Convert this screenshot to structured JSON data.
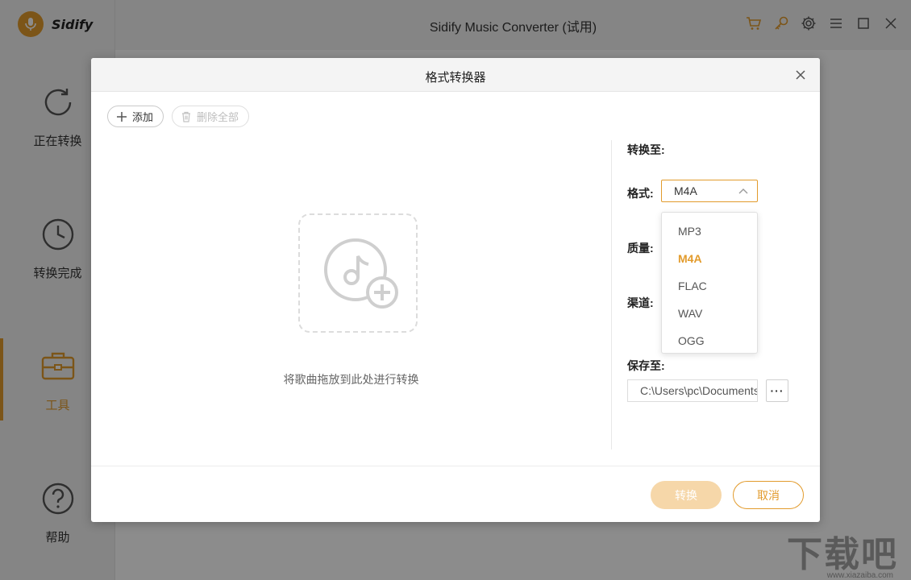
{
  "app": {
    "brand": "Sidify",
    "title": "Sidify Music Converter (试用)"
  },
  "sidebar": {
    "items": [
      {
        "label": "正在转换",
        "icon": "refresh-icon",
        "active": false
      },
      {
        "label": "转换完成",
        "icon": "clock-icon",
        "active": false
      },
      {
        "label": "工具",
        "icon": "toolbox-icon",
        "active": true
      },
      {
        "label": "帮助",
        "icon": "help-icon",
        "active": false
      }
    ]
  },
  "titlebar_icons": [
    "cart-icon",
    "key-icon",
    "gear-icon",
    "menu-icon",
    "maximize-icon",
    "close-icon"
  ],
  "dialog": {
    "title": "格式转换器",
    "add_label": "添加",
    "delete_all_label": "删除全部",
    "drop_hint": "将歌曲拖放到此处进行转换",
    "convert_to_label": "转换至:",
    "format_label": "格式:",
    "format_value": "M4A",
    "format_options": [
      "MP3",
      "M4A",
      "FLAC",
      "WAV",
      "OGG"
    ],
    "quality_label": "质量:",
    "channel_label": "渠道:",
    "save_to_label": "保存至:",
    "save_path": "C:\\Users\\pc\\Documents",
    "browse_label": "···",
    "convert_button": "转换",
    "cancel_button": "取消"
  },
  "watermark": {
    "main": "下载吧",
    "sub": "www.xiazaiba.com"
  },
  "colors": {
    "accent": "#e29b2c",
    "accent_disabled": "#f6d7a9"
  }
}
